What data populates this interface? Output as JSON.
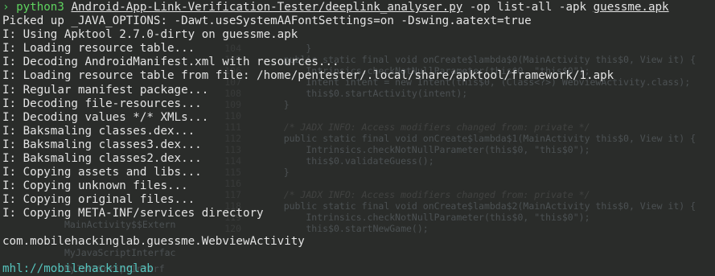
{
  "prompt": {
    "symbol": "›",
    "command": "python3",
    "script": "Android-App-Link-Verification-Tester/deeplink_analyser.py",
    "flag_op": "-op",
    "op_value": "list-all",
    "flag_apk": "-apk",
    "apk_file": "guessme.apk"
  },
  "output_lines": [
    "Picked up _JAVA_OPTIONS: -Dawt.useSystemAAFontSettings=on -Dswing.aatext=true",
    "I: Using Apktool 2.7.0-dirty on guessme.apk",
    "I: Loading resource table...",
    "I: Decoding AndroidManifest.xml with resources...",
    "I: Loading resource table from file: /home/pentester/.local/share/apktool/framework/1.apk",
    "I: Regular manifest package...",
    "I: Decoding file-resources...",
    "I: Decoding values */* XMLs...",
    "I: Baksmaling classes.dex...",
    "I: Baksmaling classes3.dex...",
    "I: Baksmaling classes2.dex...",
    "I: Copying assets and libs...",
    "I: Copying unknown files...",
    "I: Copying original files...",
    "I: Copying META-INF/services directory"
  ],
  "result_line": "com.mobilehackinglab.guessme.WebviewActivity",
  "cwd_prompt": "mhl://mobilehackinglab",
  "colors": {
    "background": "#2a2c2a",
    "text": "#e4e4e4",
    "command": "#5fd35f",
    "cwd": "#56c4bd"
  },
  "background_ide": {
    "line_numbers": [
      "104",
      "105",
      "106",
      "107",
      "108",
      "109",
      "110",
      "111",
      "112",
      "113",
      "114",
      "115",
      "116",
      "117",
      "118",
      "119",
      "120"
    ],
    "code_lines": [
      "        }",
      "    public static final void onCreate$lambda$0(MainActivity this$0, View it) {",
      "        Intrinsics.checkNotNullParameter(this$0, \"this$0\");",
      "        Intent intent = new Intent(this$0, (Class<?>) WebviewActivity.class);",
      "        this$0.startActivity(intent);",
      "    }",
      "",
      "    /* JADX INFO: Access modifiers changed from: private */",
      "    public static final void onCreate$lambda$1(MainActivity this$0, View it) {",
      "        Intrinsics.checkNotNullParameter(this$0, \"this$0\");",
      "        this$0.validateGuess();",
      "    }",
      "",
      "    /* JADX INFO: Access modifiers changed from: private */",
      "    public static final void onCreate$lambda$2(MainActivity this$0, View it) {",
      "        Intrinsics.checkNotNullParameter(this$0, \"this$0\");",
      "        this$0.startNewGame();"
    ],
    "tree_items": [
      "MainActivity$$Extern",
      "MyJavaScriptInterfac",
      "MyJavaScriptInterf"
    ]
  }
}
